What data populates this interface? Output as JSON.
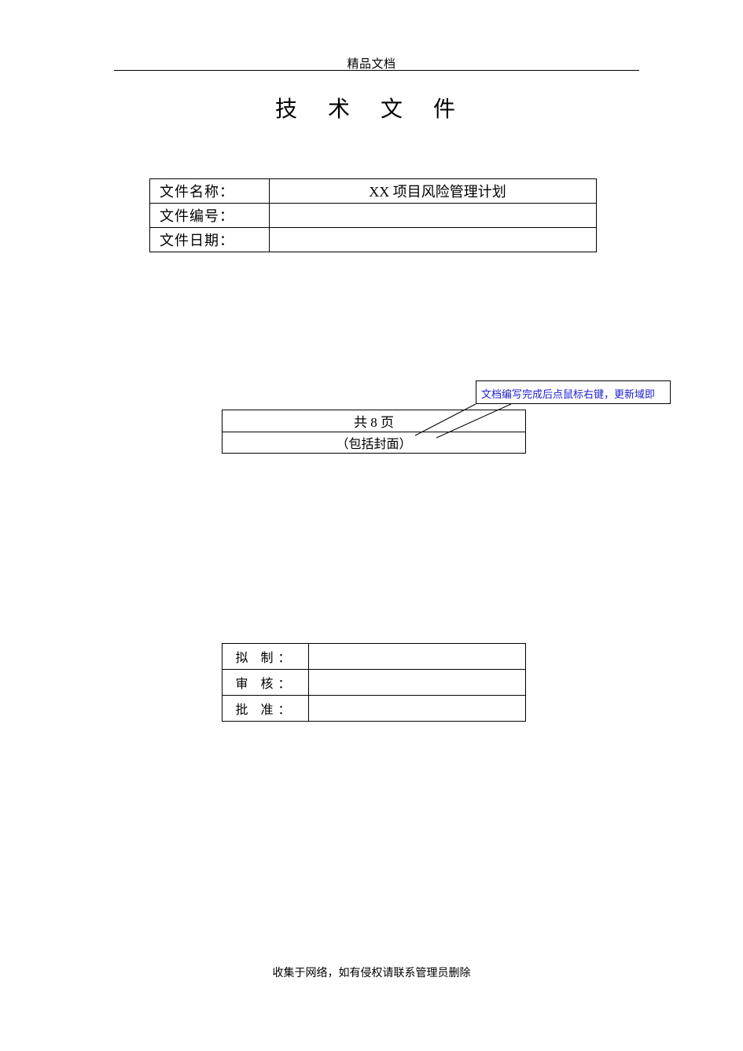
{
  "header": "精品文档",
  "title": "技 术 文 件",
  "info": {
    "row1_label": "文件名称：",
    "row1_value": "XX 项目风险管理计划",
    "row2_label": "文件编号：",
    "row2_value": "",
    "row3_label": "文件日期：",
    "row3_value": ""
  },
  "pagecount": {
    "row1": "共 8 页",
    "row2": "（包括封面）"
  },
  "callout": "文档编写完成后点鼠标右键，更新域即",
  "signatures": {
    "row1_label": "拟 制：",
    "row1_value": "",
    "row2_label": "审 核：",
    "row2_value": "",
    "row3_label": "批 准：",
    "row3_value": ""
  },
  "footer": "收集于网络，如有侵权请联系管理员删除"
}
